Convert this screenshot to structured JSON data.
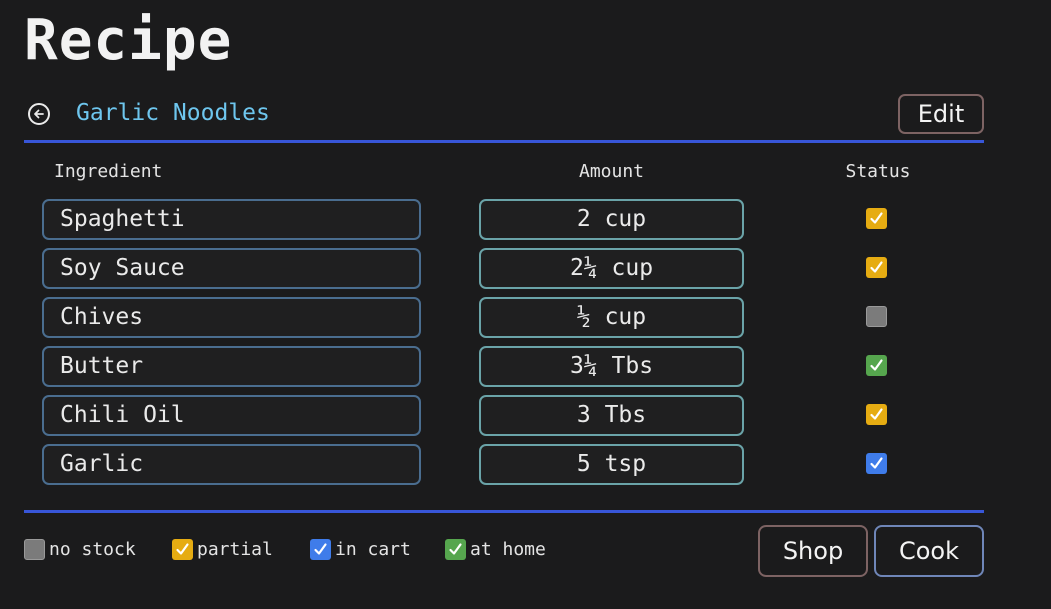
{
  "page": {
    "title": "Recipe"
  },
  "header": {
    "recipe_name": "Garlic Noodles",
    "edit_label": "Edit"
  },
  "table": {
    "columns": [
      "Ingredient",
      "Amount",
      "Status"
    ],
    "rows": [
      {
        "ingredient": "Spaghetti",
        "amount": "2 cup",
        "status": "partial"
      },
      {
        "ingredient": "Soy Sauce",
        "amount": "2¼ cup",
        "status": "partial"
      },
      {
        "ingredient": "Chives",
        "amount": "½ cup",
        "status": "no stock"
      },
      {
        "ingredient": "Butter",
        "amount": "3¼ Tbs",
        "status": "at home"
      },
      {
        "ingredient": "Chili Oil",
        "amount": "3 Tbs",
        "status": "partial"
      },
      {
        "ingredient": "Garlic",
        "amount": "5 tsp",
        "status": "in cart"
      }
    ]
  },
  "legend": [
    {
      "key": "no stock",
      "label": "no stock"
    },
    {
      "key": "partial",
      "label": "partial"
    },
    {
      "key": "in cart",
      "label": "in cart"
    },
    {
      "key": "at home",
      "label": "at home"
    }
  ],
  "status_colors": {
    "no stock": "#7b7b7b",
    "partial": "#e6ac12",
    "in cart": "#3f7cea",
    "at home": "#56a64e"
  },
  "icons": {
    "back": "back-arrow-circle-icon",
    "check": "check-icon"
  },
  "footer": {
    "shop_label": "Shop",
    "cook_label": "Cook"
  }
}
